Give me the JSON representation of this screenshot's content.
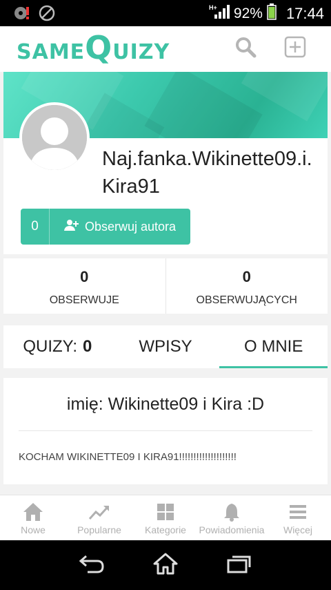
{
  "status_bar": {
    "network": "H+",
    "battery_percent": "92%",
    "time": "17:44"
  },
  "app": {
    "logo_prefix": "same",
    "logo_q": "Q",
    "logo_suffix": "uizy"
  },
  "profile": {
    "username": "Naj.fanka.Wikinette09.i.Kira91",
    "follow_count": "0",
    "follow_label": "Obserwuj autora"
  },
  "stats": [
    {
      "value": "0",
      "label": "OBSERWUJE"
    },
    {
      "value": "0",
      "label": "OBSERWUJĄCYCH"
    }
  ],
  "tabs": [
    {
      "label": "QUIZY:",
      "count": "0"
    },
    {
      "label": "WPISY"
    },
    {
      "label": "O MNIE"
    }
  ],
  "about": {
    "heading": "imię: Wikinette09 i Kira :D",
    "body": "KOCHAM WIKINETTE09 I KIRA91!!!!!!!!!!!!!!!!!!!!"
  },
  "bottom_nav": [
    {
      "label": "Nowe",
      "icon": "home-icon"
    },
    {
      "label": "Popularne",
      "icon": "trending-icon"
    },
    {
      "label": "Kategorie",
      "icon": "grid-icon"
    },
    {
      "label": "Powiadomienia",
      "icon": "bell-icon"
    },
    {
      "label": "Więcej",
      "icon": "menu-icon"
    }
  ],
  "colors": {
    "accent": "#3ec2a4",
    "nav_inactive": "#b0b0b0"
  }
}
